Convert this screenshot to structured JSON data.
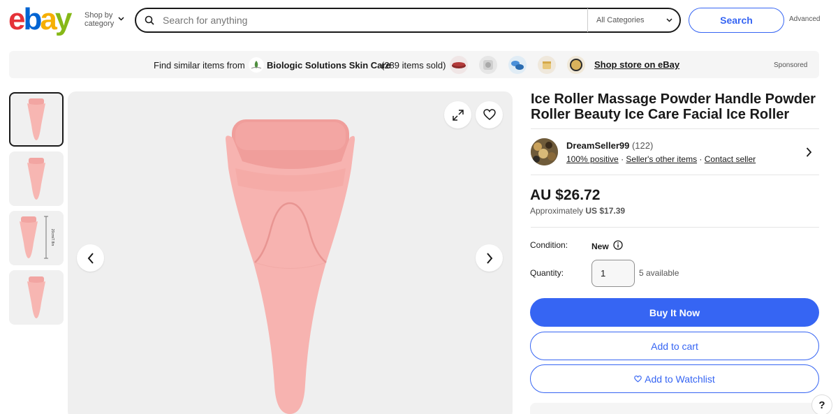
{
  "header": {
    "logo_letters": [
      "e",
      "b",
      "a",
      "y"
    ],
    "shop_by_line1": "Shop by",
    "shop_by_line2": "category",
    "search_placeholder": "Search for anything",
    "category_select": "All Categories",
    "search_button": "Search",
    "advanced_link": "Advanced"
  },
  "promo": {
    "prefix": "Find similar items from",
    "store_name": "Biologic Solutions Skin Care",
    "sold": "(289 items sold)",
    "shop_link": "Shop store on eBay",
    "sponsored": "Sponsored"
  },
  "product": {
    "title": "Ice Roller Massage Powder Handle Powder Roller Beauty Ice Care Facial Ice Roller",
    "thumbnail_count": 4,
    "thumb_dimension_text": "20cm/7.8in"
  },
  "seller": {
    "name": "DreamSeller99",
    "feedback_count": "(122)",
    "positive": "100% positive",
    "other_items": "Seller's other items",
    "contact": "Contact seller"
  },
  "pricing": {
    "price": "AU $26.72",
    "approx_prefix": "Approximately",
    "approx_value": "US $17.39"
  },
  "details": {
    "condition_label": "Condition:",
    "condition_value": "New",
    "quantity_label": "Quantity:",
    "quantity_value": "1",
    "available": "5 available"
  },
  "actions": {
    "buy_now": "Buy It Now",
    "add_to_cart": "Add to cart",
    "watchlist": "Add to Watchlist"
  },
  "help": "?",
  "colors": {
    "accent_blue": "#3665f3",
    "product_pink": "#f2a9a6",
    "logo_red": "#e53238",
    "logo_blue": "#0064d2",
    "logo_yellow": "#f5af02",
    "logo_green": "#86b817"
  }
}
